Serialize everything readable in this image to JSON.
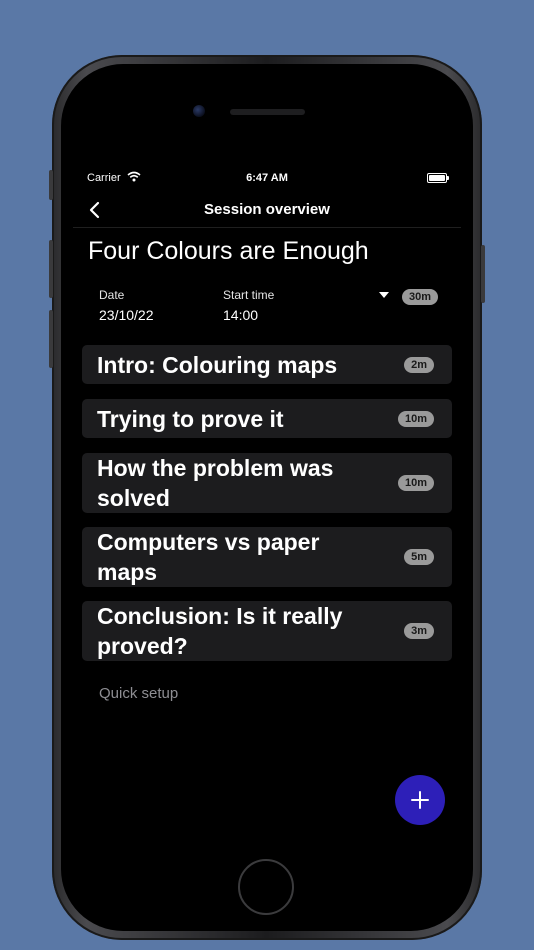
{
  "status_bar": {
    "carrier": "Carrier",
    "time": "6:47 AM"
  },
  "nav": {
    "title": "Session overview",
    "back_icon": "chevron-left-icon"
  },
  "session": {
    "title": "Four Colours are Enough",
    "date_label": "Date",
    "date_value": "23/10/22",
    "start_label": "Start time",
    "start_value": "14:00",
    "total_duration": "30m"
  },
  "talks": [
    {
      "title": "Intro: Colouring maps",
      "duration": "2m"
    },
    {
      "title": "Trying to prove it",
      "duration": "10m"
    },
    {
      "title": "How the problem was solved",
      "duration": "10m"
    },
    {
      "title": "Computers vs paper maps",
      "duration": "5m"
    },
    {
      "title": "Conclusion: Is it really proved?",
      "duration": "3m"
    }
  ],
  "quick_setup": "Quick setup",
  "fab_icon": "plus-icon",
  "colors": {
    "background": "#5a78a6",
    "card": "#1c1c1e",
    "fab": "#2d1fb8",
    "badge": "#9a9a9a"
  }
}
